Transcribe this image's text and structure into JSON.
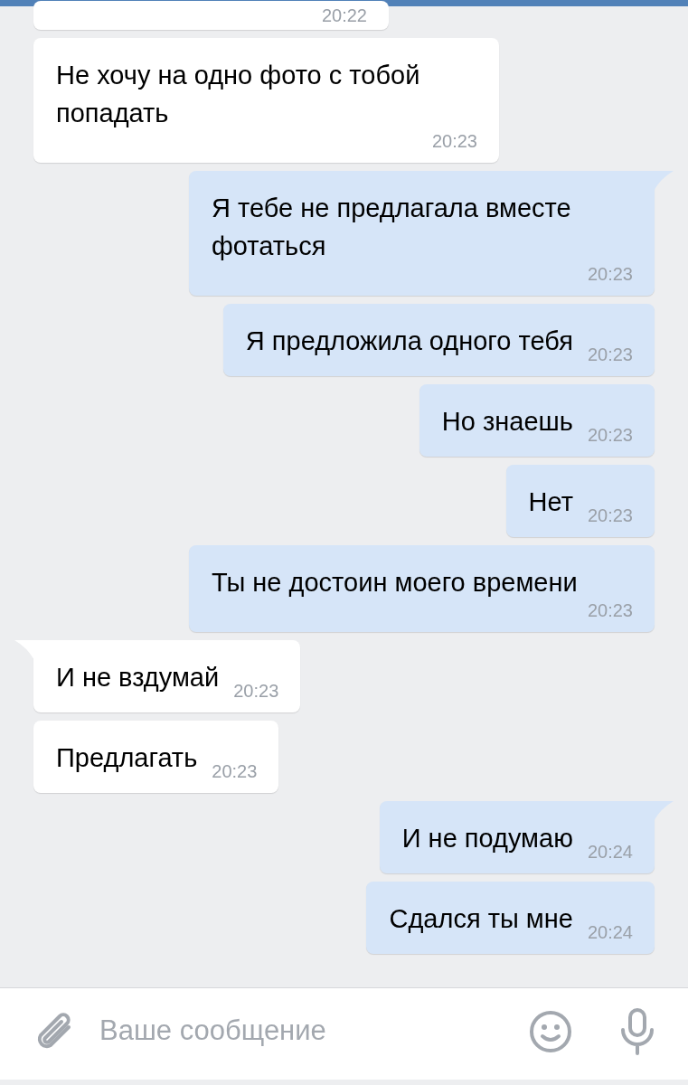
{
  "messages": [
    {
      "kind": "in",
      "time": "20:22",
      "tail": false
    },
    {
      "kind": "in",
      "text": "Не хочу на одно фото с тобой попадать",
      "time": "20:23",
      "tail": false
    },
    {
      "kind": "out",
      "text": "Я тебе не предлагала вместе фотаться",
      "time": "20:23",
      "tail": true
    },
    {
      "kind": "out",
      "text": "Я предложила одного тебя",
      "time": "20:23",
      "tail": false
    },
    {
      "kind": "out",
      "text": "Но знаешь",
      "time": "20:23",
      "tail": false
    },
    {
      "kind": "out",
      "text": "Нет",
      "time": "20:23",
      "tail": false
    },
    {
      "kind": "out",
      "text": "Ты не достоин моего времени",
      "time": "20:23",
      "tail": false
    },
    {
      "kind": "in",
      "text": "И не вздумай",
      "time": "20:23",
      "tail": true
    },
    {
      "kind": "in",
      "text": "Предлагать",
      "time": "20:23",
      "tail": false
    },
    {
      "kind": "out",
      "text": "И не подумаю",
      "time": "20:24",
      "tail": true
    },
    {
      "kind": "out",
      "text": "Сдался ты мне",
      "time": "20:24",
      "tail": false
    }
  ],
  "composer": {
    "placeholder": "Ваше сообщение"
  }
}
